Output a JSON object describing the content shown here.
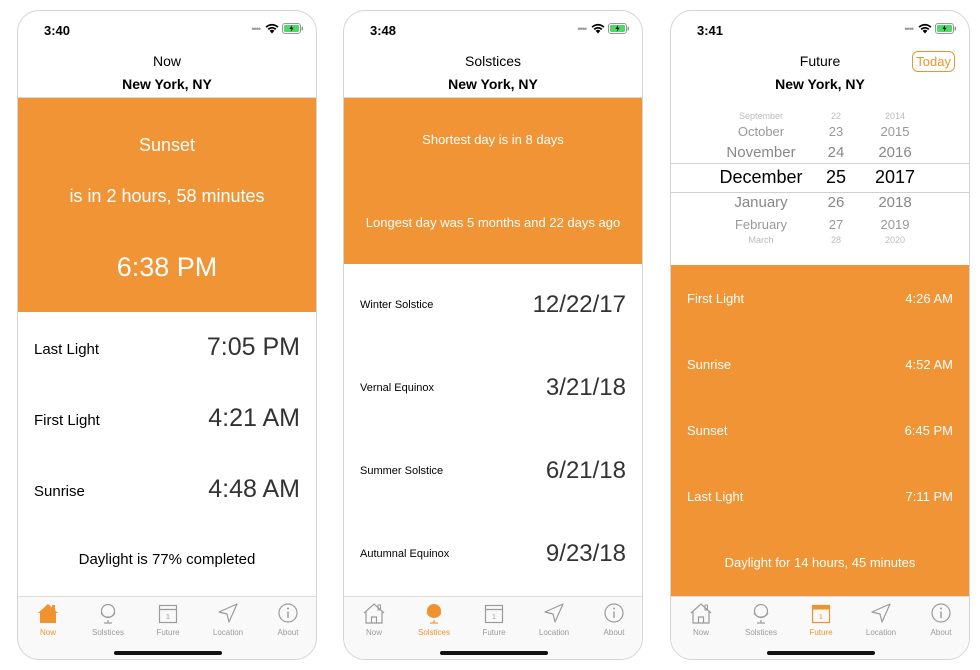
{
  "screens": [
    {
      "status_time": "3:40",
      "nav_title": "Now",
      "location": "New York, NY",
      "event_name": "Sunset",
      "event_eta": "is in 2 hours, 58 minutes",
      "event_time": "6:38 PM",
      "rows": [
        {
          "label": "Last Light",
          "value": "7:05 PM"
        },
        {
          "label": "First Light",
          "value": "4:21 AM"
        },
        {
          "label": "Sunrise",
          "value": "4:48 AM"
        }
      ],
      "footer_text": "Daylight is 77% completed",
      "active_tab": 0
    },
    {
      "status_time": "3:48",
      "nav_title": "Solstices",
      "location": "New York, NY",
      "shortest_text": "Shortest day is in 8 days",
      "longest_text": "Longest day was 5 months and 22 days ago",
      "rows": [
        {
          "label": "Winter Solstice",
          "value": "12/22/17"
        },
        {
          "label": "Vernal Equinox",
          "value": "3/21/18"
        },
        {
          "label": "Summer Solstice",
          "value": "6/21/18"
        },
        {
          "label": "Autumnal Equinox",
          "value": "9/23/18"
        }
      ],
      "active_tab": 1
    },
    {
      "status_time": "3:41",
      "nav_title": "Future",
      "today_label": "Today",
      "location": "New York, NY",
      "picker": {
        "months": [
          "September",
          "October",
          "November",
          "December",
          "January",
          "February",
          "March"
        ],
        "days": [
          "22",
          "23",
          "24",
          "25",
          "26",
          "27",
          "28"
        ],
        "years": [
          "2014",
          "2015",
          "2016",
          "2017",
          "2018",
          "2019",
          "2020"
        ]
      },
      "rows": [
        {
          "label": "First Light",
          "value": "4:26 AM"
        },
        {
          "label": "Sunrise",
          "value": "4:52 AM"
        },
        {
          "label": "Sunset",
          "value": "6:45 PM"
        },
        {
          "label": "Last Light",
          "value": "7:11 PM"
        }
      ],
      "footer_text": "Daylight for 14 hours, 45 minutes",
      "active_tab": 2
    }
  ],
  "tabs": [
    "Now",
    "Solstices",
    "Future",
    "Location",
    "About"
  ],
  "colors": {
    "accent": "#F0932F",
    "inactive": "#9B9B9B"
  }
}
